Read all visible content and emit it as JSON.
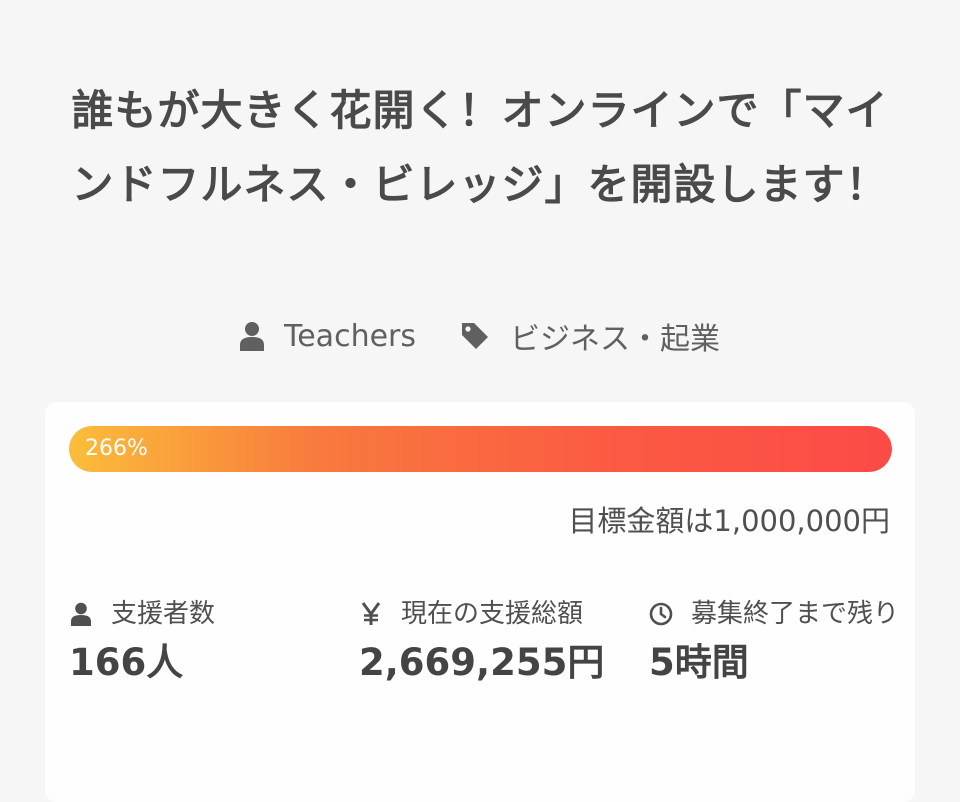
{
  "project": {
    "title": "誰もが大きく花開く！オンラインで「マインドフルネス・ビレッジ」を開設します！",
    "owner": "Teachers",
    "category": "ビジネス・起業"
  },
  "progress": {
    "percent_label": "266%",
    "fill_fraction": 1.0,
    "gradient_start": "#fbbd3a",
    "gradient_end": "#fc4a47",
    "goal_text": "目標金額は1,000,000円"
  },
  "stats": {
    "supporters": {
      "icon": "user-icon",
      "label": "支援者数",
      "value": "166人"
    },
    "amount": {
      "icon": "yen-icon",
      "label": "現在の支援総額",
      "value": "2,669,255円"
    },
    "remaining": {
      "icon": "clock-icon",
      "label": "募集終了まで残り",
      "value": "5時間"
    }
  }
}
